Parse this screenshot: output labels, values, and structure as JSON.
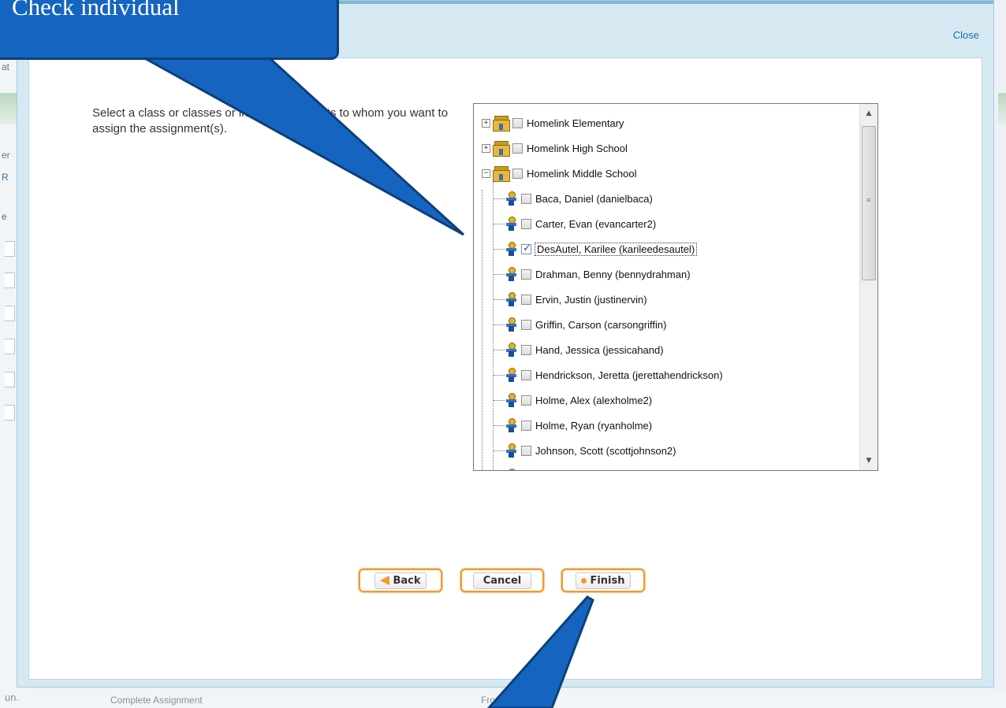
{
  "dialog": {
    "close_label": "Close",
    "instruction": "Select a class or classes or individual students to whom you want to assign the assignment(s)."
  },
  "tree": {
    "schools": [
      {
        "label": "Homelink Elementary",
        "expanded": false,
        "checked": false
      },
      {
        "label": "Homelink High School",
        "expanded": false,
        "checked": false
      },
      {
        "label": "Homelink Middle School",
        "expanded": true,
        "checked": false
      }
    ],
    "students": [
      {
        "label": "Baca, Daniel (danielbaca)",
        "checked": false
      },
      {
        "label": "Carter, Evan (evancarter2)",
        "checked": false
      },
      {
        "label": "DesAutel, Karilee (karileedesautel)",
        "checked": true
      },
      {
        "label": "Drahman, Benny (bennydrahman)",
        "checked": false
      },
      {
        "label": "Ervin, Justin (justinervin)",
        "checked": false
      },
      {
        "label": "Griffin, Carson (carsongriffin)",
        "checked": false
      },
      {
        "label": "Hand, Jessica (jessicahand)",
        "checked": false
      },
      {
        "label": "Hendrickson, Jeretta (jerettahendrickson)",
        "checked": false
      },
      {
        "label": "Holme, Alex (alexholme2)",
        "checked": false
      },
      {
        "label": "Holme, Ryan (ryanholme)",
        "checked": false
      },
      {
        "label": "Johnson, Scott (scottjohnson2)",
        "checked": false
      }
    ],
    "expand_symbol": "+",
    "collapse_symbol": "−"
  },
  "buttons": {
    "back": "Back",
    "cancel": "Cancel",
    "finish": "Finish"
  },
  "callout": {
    "text": "Check individual"
  },
  "background": {
    "bottom_text": "un.",
    "bottom_text_2": "Complete Assignment",
    "bottom_text_3": "From Key",
    "side_letters": [
      "at",
      "er",
      "R",
      "e"
    ]
  },
  "colors": {
    "accent_orange": "#f39a2c",
    "callout_blue": "#1565c0",
    "dialog_frame": "#d6e9f3",
    "link_blue": "#1f6fa3"
  }
}
